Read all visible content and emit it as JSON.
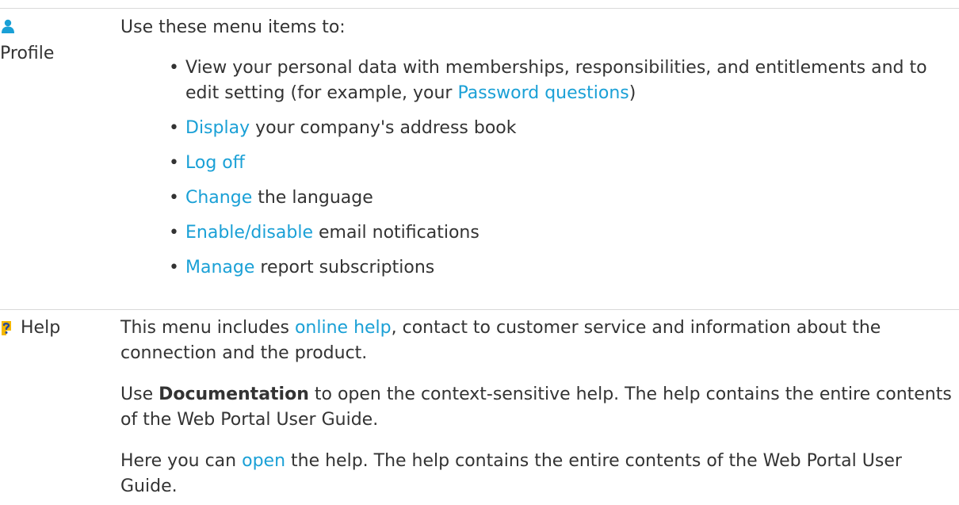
{
  "profile": {
    "label": "Profile",
    "intro": "Use these menu items to:",
    "items": [
      {
        "pre": "View your personal data with memberships, responsibilities, and entitlements and to edit setting (for example, your ",
        "link": "Password questions",
        "post": ")"
      },
      {
        "link": "Display",
        "post": " your company's address book"
      },
      {
        "link": "Log off",
        "post": ""
      },
      {
        "link": "Change",
        "post": " the language"
      },
      {
        "link": "Enable/disable",
        "post": " email notifications"
      },
      {
        "link": "Manage",
        "post": " report subscriptions"
      }
    ]
  },
  "help": {
    "label": "Help",
    "p1_pre": "This menu includes ",
    "p1_link": "online help",
    "p1_post": ", contact to customer service and information about the connection and the product.",
    "p2_pre": "Use ",
    "p2_bold": "Documentation",
    "p2_post": " to open the context-sensitive help. The help contains the entire contents of the Web Portal User Guide.",
    "p3_pre": "Here you can ",
    "p3_link": "open",
    "p3_post": " the help. The help contains the entire contents of the Web Portal User Guide."
  },
  "colors": {
    "link": "#1aa0d6",
    "text": "#333333",
    "rule": "#d9d9d9",
    "help_icon_yellow": "#f5b800",
    "help_icon_blue": "#2a4a9a"
  },
  "icons": {
    "profile": "person-icon",
    "help": "question-mark-icon"
  }
}
